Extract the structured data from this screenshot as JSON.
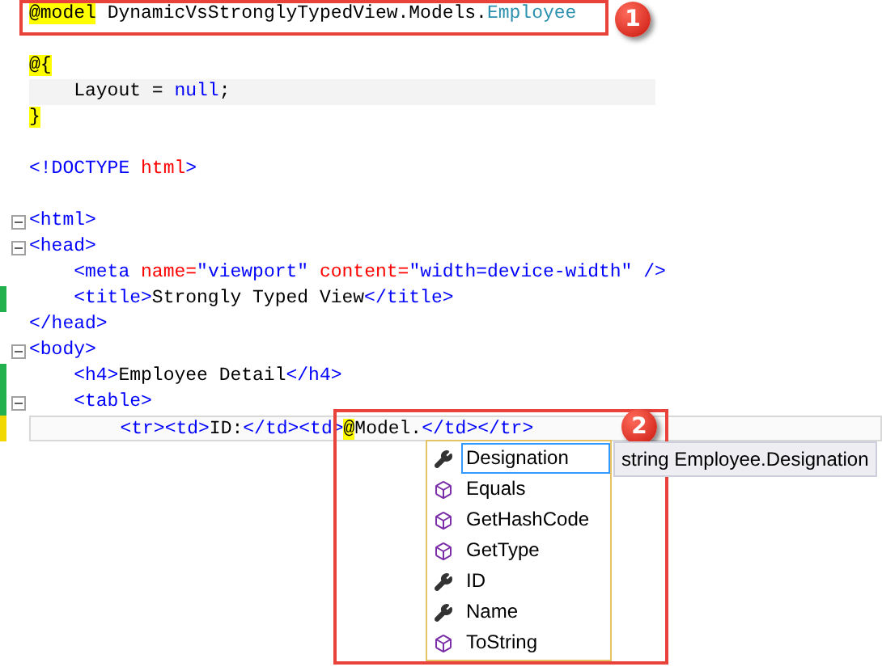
{
  "code_lines": [
    {
      "tokens": [
        {
          "t": "@model",
          "kind": "razor"
        },
        {
          "t": " DynamicVsStronglyTypedView.Models.",
          "kind": "plain"
        },
        {
          "t": "Employee",
          "kind": "type"
        }
      ],
      "fold": false,
      "modified": false,
      "current": false,
      "shaded": false
    },
    {
      "fold": false,
      "modified": false
    },
    {
      "tokens": [
        {
          "t": "@{",
          "kind": "razor"
        }
      ],
      "fold": false,
      "modified": false,
      "current": false,
      "shaded": false
    },
    {
      "tokens": [
        {
          "t": "    Layout = ",
          "kind": "plain"
        },
        {
          "t": "null",
          "kind": "keyword"
        },
        {
          "t": ";",
          "kind": "plain"
        }
      ],
      "fold": false,
      "modified": false,
      "current": false,
      "shaded": true
    },
    {
      "tokens": [
        {
          "t": "}",
          "kind": "razor"
        }
      ],
      "fold": false,
      "modified": false,
      "current": false,
      "shaded": false
    },
    {
      "fold": false,
      "modified": false
    },
    {
      "tokens": [
        {
          "t": "<!DOCTYPE",
          "kind": "tag"
        },
        {
          "t": " html",
          "kind": "attr"
        },
        {
          "t": ">",
          "kind": "tag"
        }
      ],
      "fold": false,
      "modified": false,
      "current": false,
      "shaded": false
    },
    {
      "fold": false,
      "modified": false
    },
    {
      "tokens": [
        {
          "t": "<html>",
          "kind": "tag"
        }
      ],
      "fold": true,
      "modified": false,
      "current": false,
      "shaded": false
    },
    {
      "tokens": [
        {
          "t": "<head>",
          "kind": "tag"
        }
      ],
      "fold": true,
      "modified": false,
      "current": false,
      "shaded": false
    },
    {
      "tokens": [
        {
          "t": "    <meta",
          "kind": "tag"
        },
        {
          "t": " name=",
          "kind": "attr"
        },
        {
          "t": "\"viewport\"",
          "kind": "value"
        },
        {
          "t": " content=",
          "kind": "attr"
        },
        {
          "t": "\"width=device-width\"",
          "kind": "value"
        },
        {
          "t": " />",
          "kind": "tag"
        }
      ],
      "fold": false,
      "modified": false,
      "current": false,
      "shaded": false
    },
    {
      "tokens": [
        {
          "t": "    <title>",
          "kind": "tag"
        },
        {
          "t": "Strongly Typed View",
          "kind": "plain"
        },
        {
          "t": "</title>",
          "kind": "tag"
        }
      ],
      "fold": false,
      "modified": true,
      "saved": true,
      "current": false,
      "shaded": false
    },
    {
      "tokens": [
        {
          "t": "</head>",
          "kind": "tag"
        }
      ],
      "fold": false,
      "modified": false,
      "current": false,
      "shaded": false
    },
    {
      "tokens": [
        {
          "t": "<body>",
          "kind": "tag"
        }
      ],
      "fold": true,
      "modified": false,
      "current": false,
      "shaded": false
    },
    {
      "tokens": [
        {
          "t": "    <h4>",
          "kind": "tag"
        },
        {
          "t": "Employee Detail",
          "kind": "plain"
        },
        {
          "t": "</h4>",
          "kind": "tag"
        }
      ],
      "fold": false,
      "modified": true,
      "saved": true,
      "current": false,
      "shaded": false
    },
    {
      "tokens": [
        {
          "t": "    <table>",
          "kind": "tag"
        }
      ],
      "fold": true,
      "modified": true,
      "saved": true,
      "current": false,
      "shaded": false
    },
    {
      "tokens": [
        {
          "t": "        <tr><td>",
          "kind": "tag"
        },
        {
          "t": "ID:",
          "kind": "plain"
        },
        {
          "t": "</td><td>",
          "kind": "tag"
        },
        {
          "t": "@",
          "kind": "razor"
        },
        {
          "t": "Model.",
          "kind": "plain"
        },
        {
          "t": "</td></tr>",
          "kind": "tag"
        }
      ],
      "fold": false,
      "modified": true,
      "saved": false,
      "current": true,
      "shaded": false
    }
  ],
  "completion": {
    "items": [
      {
        "label": "Designation",
        "kind": "property",
        "selected": true
      },
      {
        "label": "Equals",
        "kind": "method",
        "selected": false
      },
      {
        "label": "GetHashCode",
        "kind": "method",
        "selected": false
      },
      {
        "label": "GetType",
        "kind": "method",
        "selected": false
      },
      {
        "label": "ID",
        "kind": "property",
        "selected": false
      },
      {
        "label": "Name",
        "kind": "property",
        "selected": false
      },
      {
        "label": "ToString",
        "kind": "method",
        "selected": false
      }
    ]
  },
  "tooltip": "string Employee.Designation",
  "callouts": [
    "1",
    "2"
  ]
}
